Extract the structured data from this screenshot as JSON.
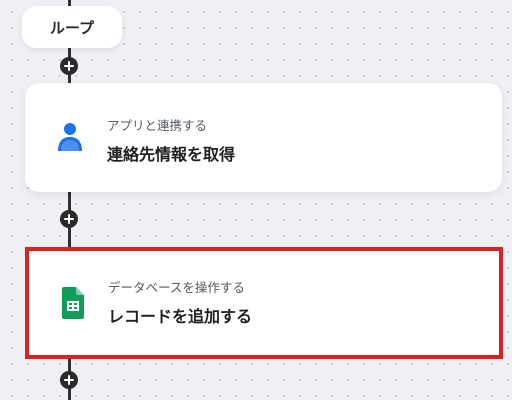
{
  "loop_node": {
    "label": "ループ"
  },
  "steps": [
    {
      "caption": "アプリと連携する",
      "title": "連絡先情報を取得",
      "icon": "contact-person-icon",
      "icon_color": "#1a73e8"
    },
    {
      "caption": "データベースを操作する",
      "title": "レコードを追加する",
      "icon": "google-sheets-icon",
      "icon_color": "#0f9d58",
      "highlighted": true,
      "highlight_color": "#e02020"
    }
  ],
  "add_buttons": {
    "icon": "plus-icon",
    "color": "#2a2a2a"
  },
  "colors": {
    "canvas": "#eef0f4",
    "connector": "#2f2f2f"
  }
}
